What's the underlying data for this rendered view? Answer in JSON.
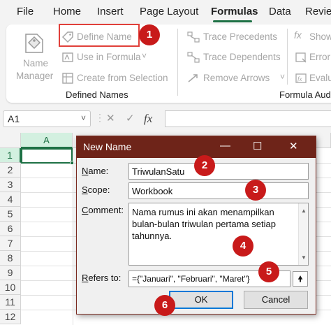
{
  "ribbon_tabs": [
    {
      "label": "File",
      "active": false
    },
    {
      "label": "Home",
      "active": false
    },
    {
      "label": "Insert",
      "active": false
    },
    {
      "label": "Page Layout",
      "active": false
    },
    {
      "label": "Formulas",
      "active": true
    },
    {
      "label": "Data",
      "active": false
    },
    {
      "label": "Review",
      "active": false
    }
  ],
  "ribbon": {
    "name_manager": {
      "line1": "Name",
      "line2": "Manager",
      "icon": "name-manager-icon"
    },
    "define_name": {
      "label": "Define Name",
      "icon": "tag-icon"
    },
    "use_in_formula": {
      "label": "Use in Formula",
      "icon": "use-in-formula-icon",
      "caret": "˅"
    },
    "create_from_selection": {
      "label": "Create from Selection",
      "icon": "create-from-selection-icon"
    },
    "defined_names_group": "Defined Names",
    "trace_precedents": {
      "label": "Trace Precedents",
      "icon": "trace-precedents-icon"
    },
    "trace_dependents": {
      "label": "Trace Dependents",
      "icon": "trace-dependents-icon"
    },
    "remove_arrows": {
      "label": "Remove Arrows",
      "icon": "remove-arrows-icon",
      "caret": "˅"
    },
    "show_formulas": {
      "label": "Show",
      "icon": "show-formulas-icon"
    },
    "error_checking": {
      "label": "Error",
      "icon": "error-checking-icon"
    },
    "evaluate_formula": {
      "label": "Evalu",
      "icon": "evaluate-formula-icon"
    },
    "formula_auditing_group": "Formula Audit"
  },
  "formula_bar": {
    "name_box": "A1",
    "name_box_caret": "˅",
    "cancel": "✕",
    "enter": "✓",
    "fx": "fx",
    "value": ""
  },
  "grid": {
    "columns": [
      "A"
    ],
    "rows": [
      "1",
      "2",
      "3",
      "4",
      "5",
      "6",
      "7",
      "8",
      "9",
      "10",
      "11",
      "12"
    ],
    "active_cell": "A1"
  },
  "dialog": {
    "title": "New Name",
    "minimize": "—",
    "maximize": "☐",
    "close": "✕",
    "name_label": "Name:",
    "name_label_u": "N",
    "name_label_rest": "ame:",
    "name_value": "TriwulanSatu",
    "scope_label_u": "S",
    "scope_label_rest": "cope:",
    "scope_value": "Workbook",
    "comment_label_u": "C",
    "comment_label_rest": "omment:",
    "comment_value": "Nama rumus ini akan menampilkan bulan-bulan triwulan pertama setiap tahunnya.",
    "refers_label_u": "R",
    "refers_label_rest": "efers to:",
    "refers_value": "={\"Januari\", \"Februari\", \"Maret\"}",
    "collapse_icon": "🠝",
    "ok_label": "OK",
    "cancel_label": "Cancel"
  },
  "callouts": [
    "1",
    "2",
    "3",
    "4",
    "5",
    "6"
  ],
  "colors": {
    "accent": "#1e7145",
    "dialog_title": "#6e2419",
    "callout": "#c81a1a",
    "highlight": "#e0403a"
  }
}
